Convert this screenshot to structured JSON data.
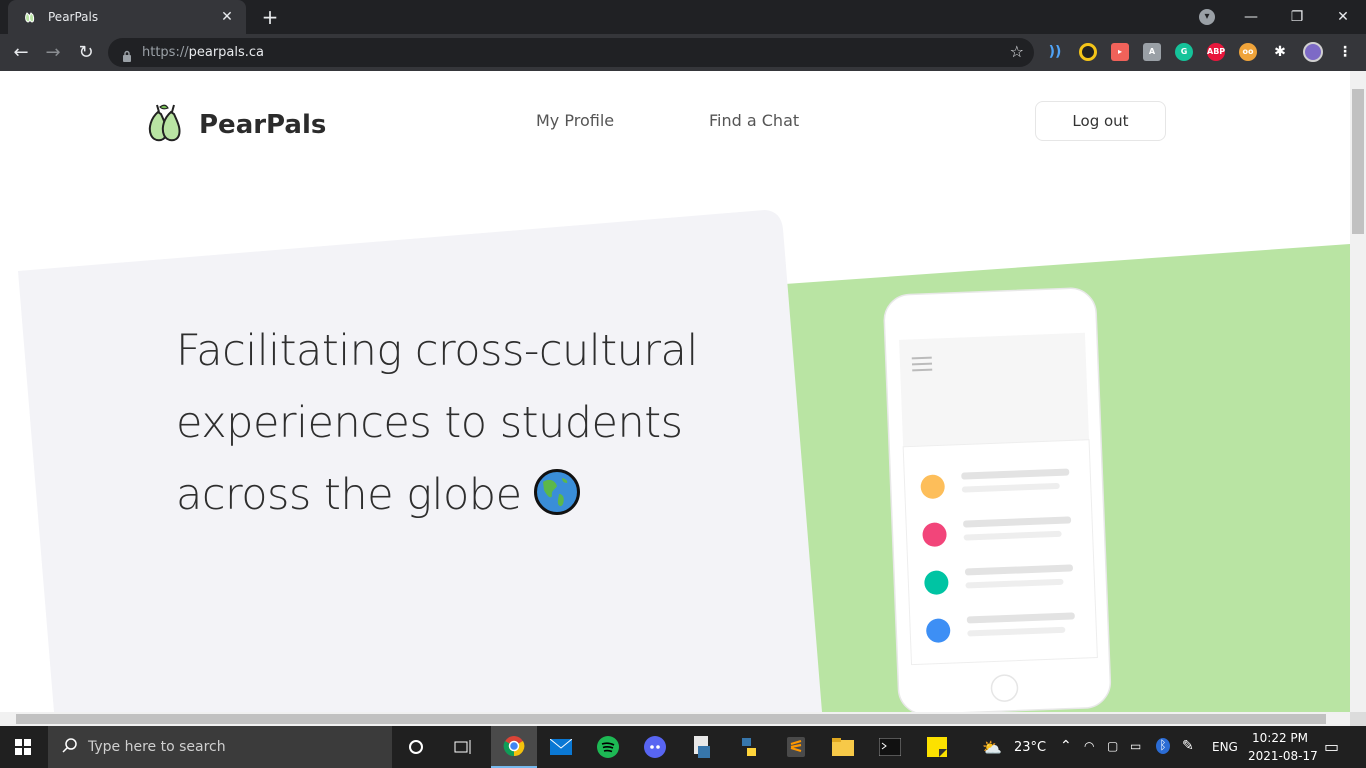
{
  "browser": {
    "tab_title": "PearPals",
    "url_scheme": "https://",
    "url_host": "pearpals.ca"
  },
  "header": {
    "brand": "PearPals",
    "nav": [
      "My Profile",
      "Find a Chat"
    ],
    "logout": "Log out"
  },
  "hero": {
    "lines": [
      "Facilitating cross-cultural",
      "experiences to students",
      "across the globe"
    ],
    "emoji_icon": "earth-americas-icon"
  },
  "colors": {
    "green_panel": "#b9e4a3",
    "gray_panel": "#f3f3f7",
    "avatar_colors": [
      "#fdbe5a",
      "#f2457a",
      "#00c4a3",
      "#3d8ff5"
    ]
  },
  "taskbar": {
    "search_placeholder": "Type here to search",
    "weather": "23°C",
    "language": "ENG",
    "time": "10:22 PM",
    "date": "2021-08-17"
  }
}
